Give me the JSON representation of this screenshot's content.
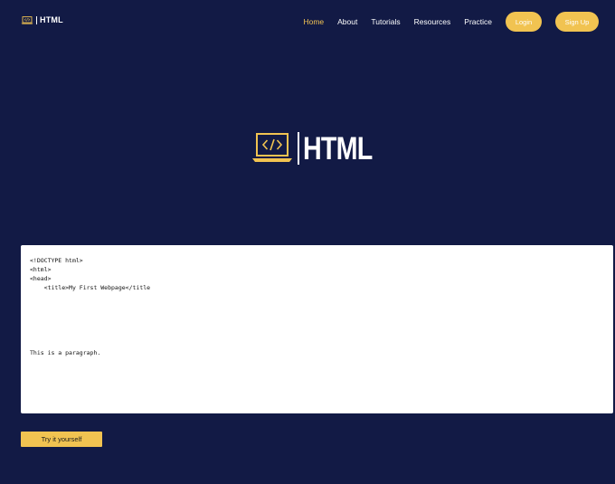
{
  "brand": {
    "label": "HTML",
    "icon": "laptop-code-icon"
  },
  "nav": {
    "items": [
      "Home",
      "About",
      "Tutorials",
      "Resources",
      "Practice"
    ],
    "login": "Login",
    "signup": "Sign Up"
  },
  "hero": {
    "title": "HTML",
    "icon": "laptop-code-icon"
  },
  "code": {
    "lines": [
      "<!DOCTYPE html>",
      "<html>",
      "<head>",
      "    <title>My First Webpage</title"
    ],
    "paragraph": "This is a paragraph."
  },
  "try_button": "Try it yourself",
  "colors": {
    "background": "#121a45",
    "accent": "#f1c351",
    "text": "#ffffff"
  }
}
